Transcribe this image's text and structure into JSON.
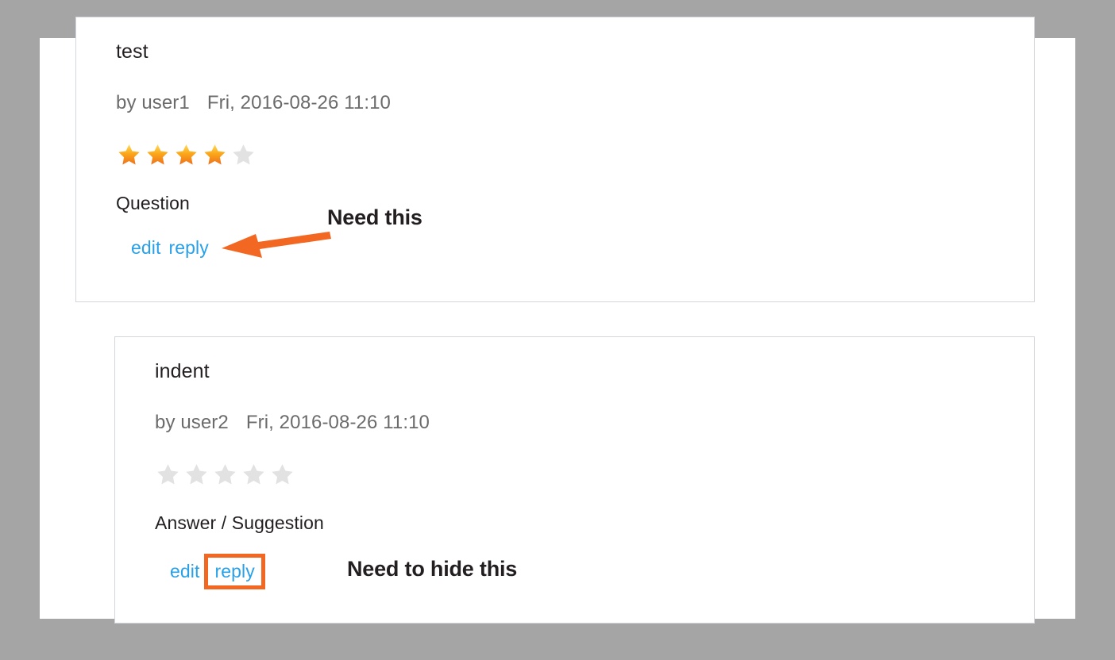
{
  "canvas": {
    "background_color": "#a5a5a5",
    "page_background": "#ffffff"
  },
  "colors": {
    "link": "#29a0e8",
    "highlight": "#f26722",
    "star_filled_top": "#ffd24d",
    "star_filled_bottom": "#f07818",
    "star_empty": "#e2e2e2",
    "text": "#231f20",
    "meta_text": "#6b6b6b",
    "box_border": "#d3d7db"
  },
  "comments": [
    {
      "title": "test",
      "by_label": "by user1",
      "date": "Fri, 2016-08-26 11:10",
      "rating": 4,
      "rating_max": 5,
      "body": "Question",
      "edit_label": "edit",
      "reply_label": "reply",
      "reply_highlighted": false
    },
    {
      "title": "indent",
      "by_label": "by user2",
      "date": "Fri, 2016-08-26 11:10",
      "rating": 0,
      "rating_max": 5,
      "body": "Answer / Suggestion",
      "edit_label": "edit",
      "reply_label": "reply",
      "reply_highlighted": true
    }
  ],
  "annotations": [
    {
      "id": "need-this",
      "text": "Need this",
      "has_arrow": true,
      "arrow_color": "#f26722",
      "arrow_points_to": "edit reply links of first comment"
    },
    {
      "id": "need-to-hide",
      "text": "Need to hide this",
      "has_arrow": false,
      "highlight_box_color": "#f26722",
      "highlight_target": "reply link of second comment"
    }
  ]
}
